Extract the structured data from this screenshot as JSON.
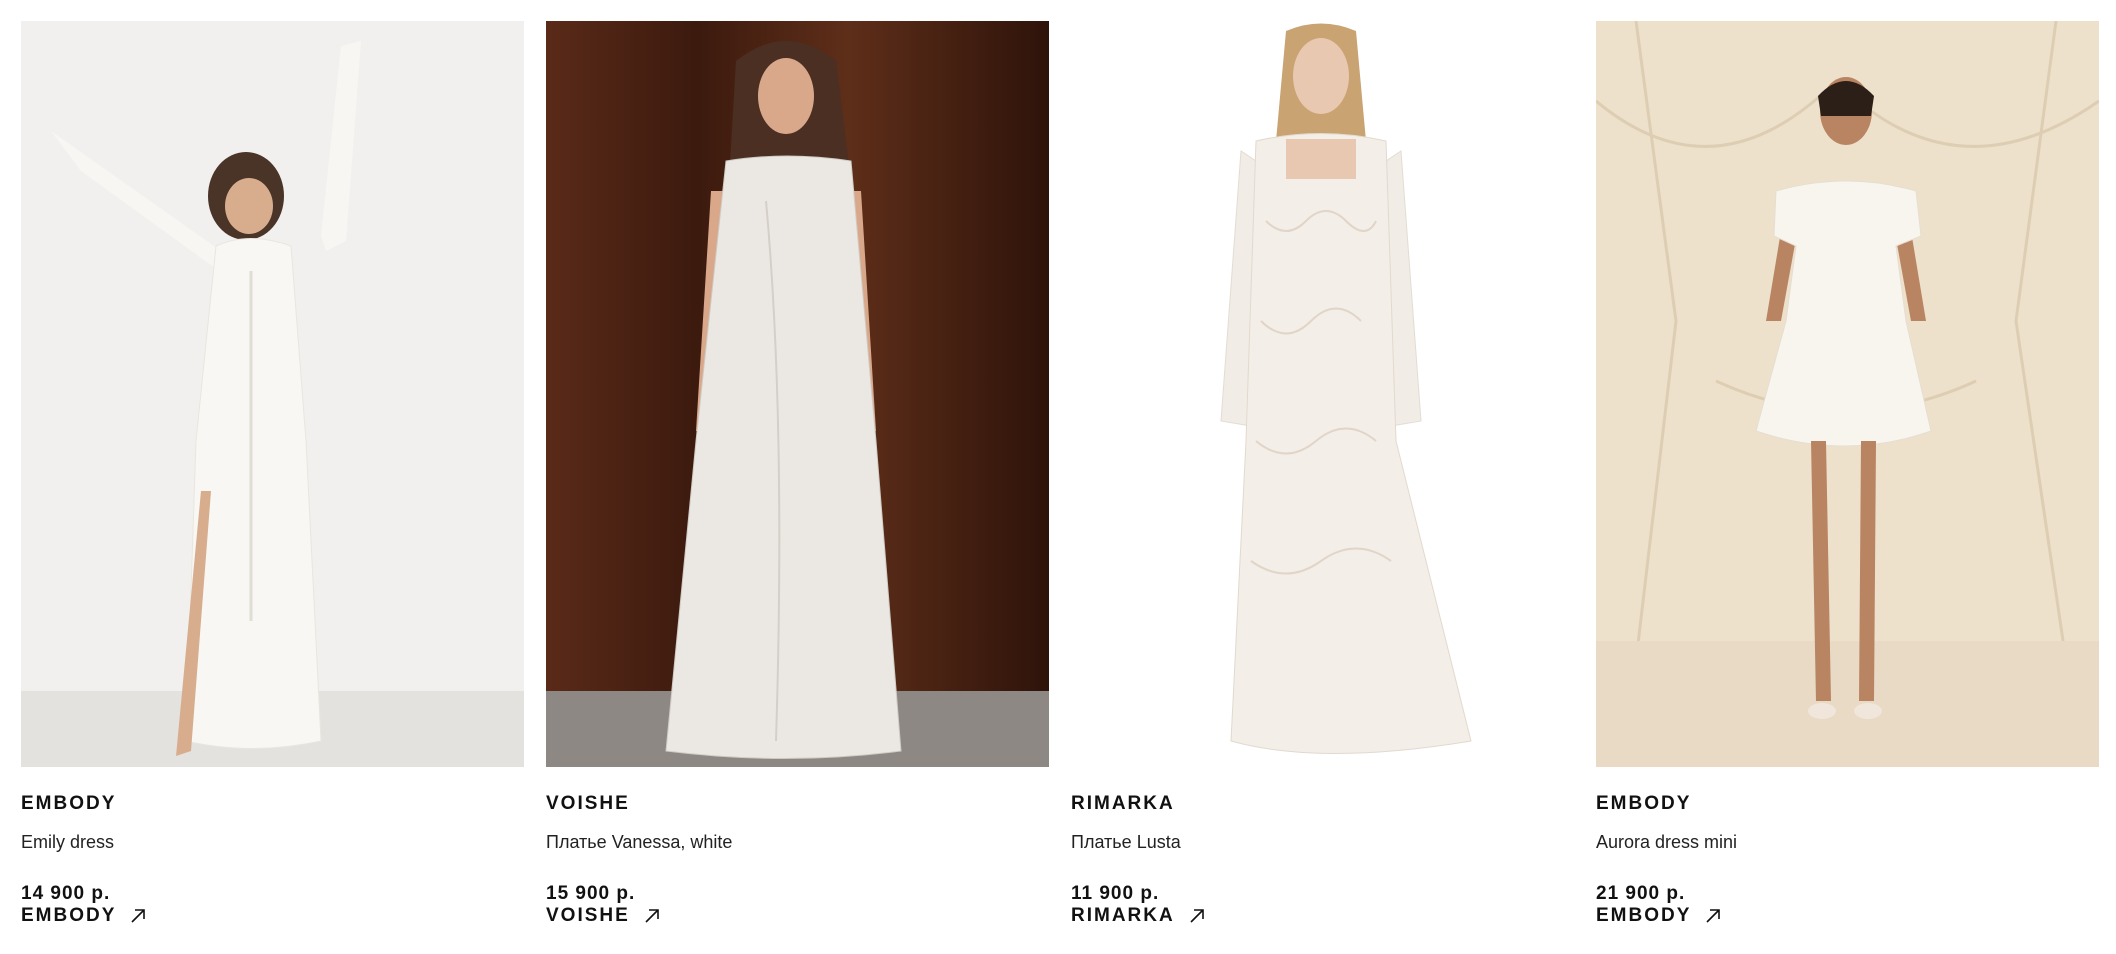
{
  "products": [
    {
      "brand": "EMBODY",
      "name": "Emily dress",
      "price": "14 900 р.",
      "link_label": "EMBODY",
      "image_alt": "Model in white lace buttoned maxi dress against white wall",
      "palette": {
        "bg": "#f1f0ee",
        "floor": "#e4e2de",
        "dress": "#f7f6f2",
        "skin": "#d7ad8e",
        "hair": "#4a3327"
      }
    },
    {
      "brand": "VOISHE",
      "name": "Платье Vanessa, white",
      "price": "15 900 р.",
      "link_label": "VOISHE",
      "image_alt": "Model in white satin slip maxi dress against dark wood panels",
      "palette": {
        "bg": "#4a2214",
        "floor": "#8e8884",
        "dress": "#e9e6e1",
        "skin": "#d9a88b",
        "hair": "#4b2f22"
      }
    },
    {
      "brand": "RIMARKA",
      "name": "Платье Lusta",
      "price": "11 900 р.",
      "link_label": "RIMARKA",
      "image_alt": "Model in white long-sleeve lace gown on white background",
      "palette": {
        "bg": "#ffffff",
        "floor": "#ffffff",
        "dress": "#f1ece6",
        "skin": "#e8c8b0",
        "hair": "#c9a372"
      }
    },
    {
      "brand": "EMBODY",
      "name": "Aurora dress mini",
      "price": "21 900 р.",
      "link_label": "EMBODY",
      "image_alt": "Model in white ruched off-shoulder mini dress against cream draped backdrop",
      "palette": {
        "bg": "#ede1cc",
        "floor": "#e8dac4",
        "dress": "#f8f5ef",
        "skin": "#b98462",
        "hair": "#2b1f18"
      }
    }
  ]
}
